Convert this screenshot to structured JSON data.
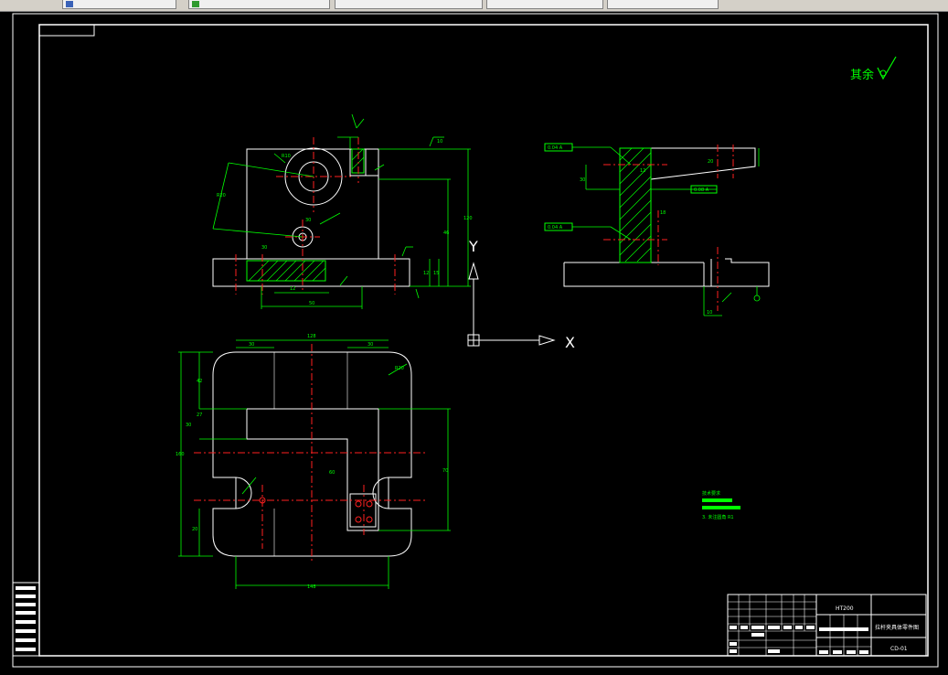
{
  "tabs": [
    {
      "label": "",
      "icon": "document-icon"
    },
    {
      "label": "",
      "icon": "drawing-icon"
    },
    {
      "label": "",
      "icon": ""
    },
    {
      "label": "",
      "icon": ""
    },
    {
      "label": "",
      "icon": ""
    }
  ],
  "drawing": {
    "rough_symbol_text": "其余",
    "axis_y_label": "Y",
    "axis_x_label": "X",
    "colors": {
      "outline": "#ffffff",
      "dimension": "#00ff00",
      "centerline": "#ff2020",
      "hatch": "#00ff00"
    }
  },
  "front_view": {
    "dims": [
      "R20",
      "R10",
      "30",
      "120",
      "46",
      "12",
      "15",
      "12",
      "50",
      "30",
      "10"
    ]
  },
  "side_view": {
    "tolerance_labels": [
      "0.04 A",
      "0.08 A",
      "0.04 A"
    ],
    "dims": [
      "12",
      "20",
      "18",
      "30",
      "10"
    ]
  },
  "top_view": {
    "dims": [
      "128",
      "30",
      "30",
      "R20",
      "160",
      "42",
      "30",
      "27",
      "70",
      "60",
      "20",
      "148"
    ]
  },
  "notes": {
    "title": "技术要求",
    "lines": [
      "",
      "",
      "3. 未注圆角 R1"
    ]
  },
  "title_block": {
    "material": "HT200",
    "part_name": "拉杆夹具体零件图",
    "drawing_no": "CD-01"
  }
}
